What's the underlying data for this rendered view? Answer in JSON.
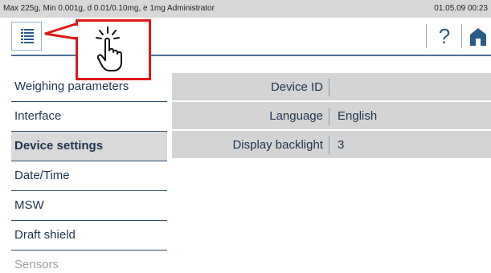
{
  "status_bar": {
    "left_text": "Max 225g, Min 0.001g, d 0.01/0.10mg, e 1mg  Administrator",
    "right_text": "01.05.09 00:23"
  },
  "toolbar": {
    "menu_icon": "list-menu-icon",
    "help_label": "?",
    "help_icon": "help-icon",
    "home_icon": "home-icon"
  },
  "sidebar": {
    "items": [
      {
        "label": "Weighing parameters",
        "active": false
      },
      {
        "label": "Interface",
        "active": false
      },
      {
        "label": "Device settings",
        "active": true
      },
      {
        "label": "Date/Time",
        "active": false
      },
      {
        "label": "MSW",
        "active": false
      },
      {
        "label": "Draft shield",
        "active": false
      },
      {
        "label": "Sensors",
        "active": false
      }
    ]
  },
  "settings": {
    "rows": [
      {
        "label": "Device ID",
        "value": ""
      },
      {
        "label": "Language",
        "value": "English"
      },
      {
        "label": "Display backlight",
        "value": "3"
      }
    ]
  },
  "callout": {
    "icon": "tap-hand-icon"
  },
  "colors": {
    "accent": "#2a5a86",
    "callout_border": "#e01818",
    "row_bg": "#d4d4d4",
    "active_item_bg": "#d9d9d9"
  }
}
